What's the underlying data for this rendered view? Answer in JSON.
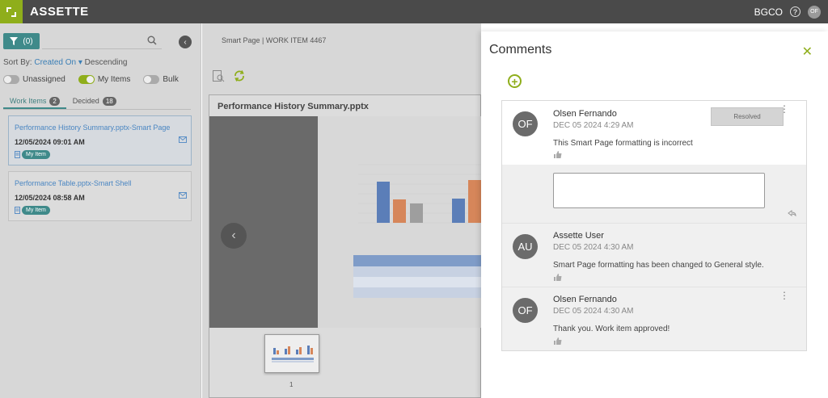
{
  "app": {
    "name": "ASSETTE",
    "org": "BGCO",
    "help_glyph": "?",
    "user_initials": "OF",
    "brand_color": "#8fae1b"
  },
  "left": {
    "filter_count": "(0)",
    "sort_by_label": "Sort By:",
    "sort_field": "Created On",
    "sort_order": "Descending",
    "toggles": [
      {
        "label": "Unassigned",
        "on": false
      },
      {
        "label": "My Items",
        "on": true
      },
      {
        "label": "Bulk",
        "on": false
      }
    ],
    "tabs": [
      {
        "label": "Work Items",
        "count": "2"
      },
      {
        "label": "Decided",
        "count": "18"
      }
    ],
    "cards": [
      {
        "title": "Performance History Summary.pptx-Smart Page",
        "date": "12/05/2024 09:01 AM",
        "badge": "My Item"
      },
      {
        "title": "Performance Table.pptx-Smart Shell",
        "date": "12/05/2024 08:58 AM",
        "badge": "My Item"
      }
    ]
  },
  "center": {
    "breadcrumb": "Smart Page | WORK ITEM 4467",
    "file_title": "Performance History Summary.pptx",
    "thumb_number": "1"
  },
  "comments": {
    "title": "Comments",
    "resolved_label": "Resolved",
    "items": [
      {
        "initials": "OF",
        "name": "Olsen Fernando",
        "date": "DEC 05 2024 4:29 AM",
        "text": "This Smart Page formatting is incorrect"
      },
      {
        "initials": "AU",
        "name": "Assette User",
        "date": "DEC 05 2024 4:30 AM",
        "text": "Smart Page formatting has been changed to General style."
      },
      {
        "initials": "OF",
        "name": "Olsen Fernando",
        "date": "DEC 05 2024 4:30 AM",
        "text": "Thank you. Work item approved!"
      }
    ]
  }
}
